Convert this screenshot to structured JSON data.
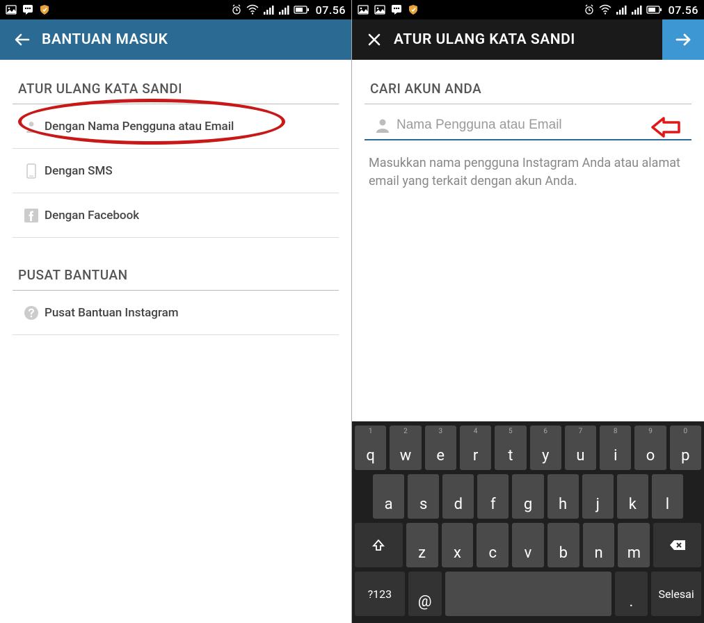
{
  "statusbar": {
    "time": "07.56"
  },
  "left": {
    "header": {
      "title": "BANTUAN MASUK"
    },
    "section_reset": {
      "title": "ATUR ULANG KATA SANDI",
      "items": [
        {
          "label": "Dengan Nama Pengguna atau Email"
        },
        {
          "label": "Dengan SMS"
        },
        {
          "label": "Dengan Facebook"
        }
      ]
    },
    "section_help": {
      "title": "PUSAT BANTUAN",
      "items": [
        {
          "label": "Pusat Bantuan Instagram"
        }
      ]
    }
  },
  "right": {
    "header": {
      "title": "ATUR ULANG KATA SANDI"
    },
    "section": {
      "title": "CARI AKUN ANDA"
    },
    "input": {
      "placeholder": "Nama Pengguna atau Email",
      "value": ""
    },
    "hint": "Masukkan nama pengguna Instagram Anda atau alamat email yang terkait dengan akun Anda."
  },
  "keyboard": {
    "row1": [
      {
        "k": "q",
        "s": "1"
      },
      {
        "k": "w",
        "s": "2"
      },
      {
        "k": "e",
        "s": "3"
      },
      {
        "k": "r",
        "s": "4"
      },
      {
        "k": "t",
        "s": "5"
      },
      {
        "k": "y",
        "s": "6"
      },
      {
        "k": "u",
        "s": "7"
      },
      {
        "k": "i",
        "s": "8"
      },
      {
        "k": "o",
        "s": "9"
      },
      {
        "k": "p",
        "s": "0"
      }
    ],
    "row2": [
      {
        "k": "a"
      },
      {
        "k": "s"
      },
      {
        "k": "d"
      },
      {
        "k": "f"
      },
      {
        "k": "g"
      },
      {
        "k": "h"
      },
      {
        "k": "j"
      },
      {
        "k": "k"
      },
      {
        "k": "l"
      }
    ],
    "row3": [
      {
        "k": "z"
      },
      {
        "k": "x"
      },
      {
        "k": "c"
      },
      {
        "k": "v"
      },
      {
        "k": "b"
      },
      {
        "k": "n"
      },
      {
        "k": "m"
      }
    ],
    "row4": {
      "sym": "?123",
      "at": "@",
      "dot": ".",
      "done": "Selesai"
    }
  }
}
